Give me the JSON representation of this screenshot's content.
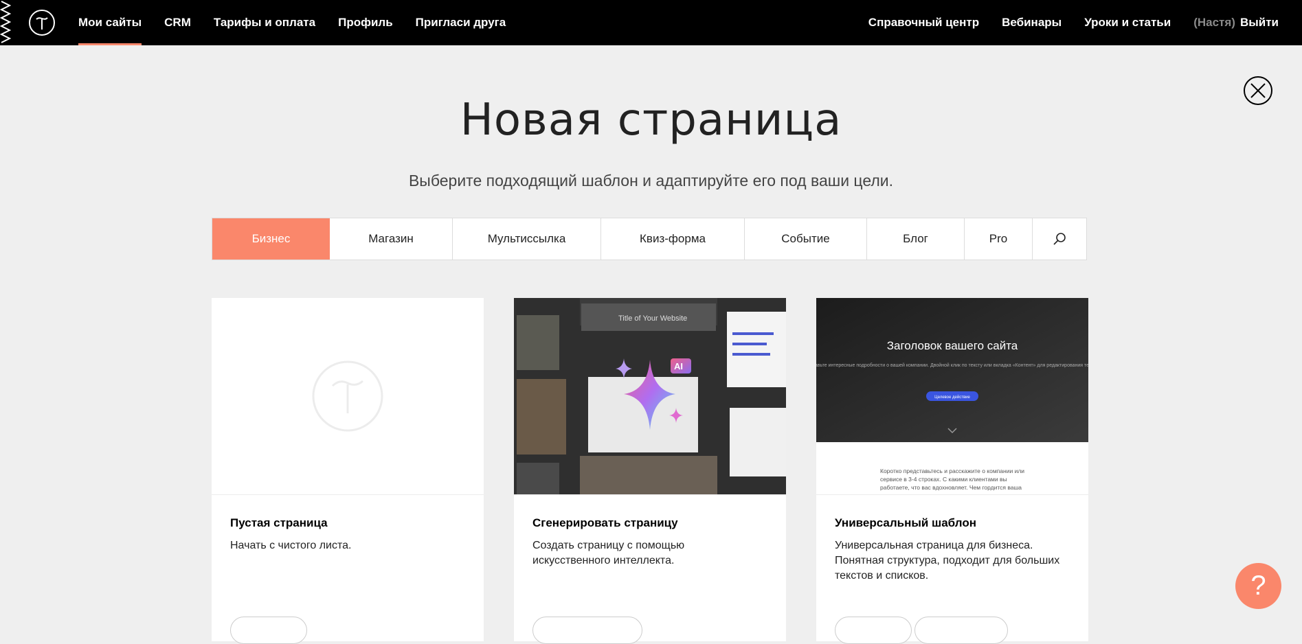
{
  "nav": {
    "logo_icon": "tilda-logo-icon",
    "left": [
      {
        "label": "Мои сайты",
        "active": true
      },
      {
        "label": "CRM",
        "active": false
      },
      {
        "label": "Тарифы и оплата",
        "active": false
      },
      {
        "label": "Профиль",
        "active": false
      },
      {
        "label": "Пригласи друга",
        "active": false
      }
    ],
    "right": [
      {
        "label": "Справочный центр"
      },
      {
        "label": "Вебинары"
      },
      {
        "label": "Уроки и статьи"
      }
    ],
    "user": "(Настя)",
    "logout": "Выйти"
  },
  "header": {
    "title": "Новая страница",
    "subtitle": "Выберите подходящий шаблон и адаптируйте его под ваши цели."
  },
  "tabs": [
    {
      "label": "Бизнес",
      "active": true
    },
    {
      "label": "Магазин",
      "active": false
    },
    {
      "label": "Мультиссылка",
      "active": false
    },
    {
      "label": "Квиз-форма",
      "active": false
    },
    {
      "label": "Событие",
      "active": false
    },
    {
      "label": "Блог",
      "active": false
    },
    {
      "label": "Pro",
      "active": false
    }
  ],
  "search_icon": "search-icon",
  "cards": [
    {
      "title": "Пустая страница",
      "description": "Начать с чистого листа."
    },
    {
      "title": "Сгенерировать страницу",
      "description": "Создать страницу с помощью искусственного интеллекта.",
      "badge": "AI",
      "preview_title": "Title of Your Website"
    },
    {
      "title": "Универсальный шаблон",
      "description": "Универсальная страница для бизнеса. Понятная структура, подходит для больших текстов и списков.",
      "preview_heading": "Заголовок вашего сайта",
      "preview_sub": "Добавьте интересные подробности о вашей компании. Двойной клик по тексту или вкладка «Контент» для редактирования текста",
      "preview_button": "Целевое действие",
      "preview_text": "Коротко представьтесь и расскажите о компании или сервисе в 3-4 строках. С какими клиентами вы работаете, что вас вдохновляет. Чем гордится ваша команда, какие у нее ценности и мотивация."
    }
  ],
  "colors": {
    "accent": "#fa876b",
    "topbar": "#000000",
    "background": "#efefef"
  },
  "help": {
    "label": "?"
  }
}
